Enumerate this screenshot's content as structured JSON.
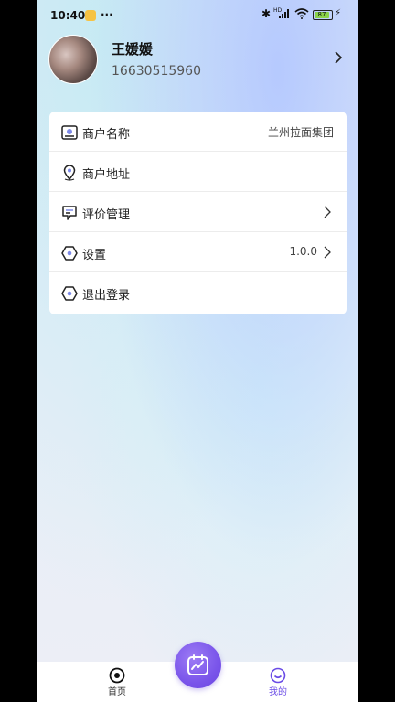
{
  "status_bar": {
    "time": "10:40",
    "dots": "···",
    "hd_label": "HD",
    "battery_level": "87"
  },
  "profile": {
    "name": "王媛媛",
    "phone": "16630515960"
  },
  "menu": {
    "items": [
      {
        "label": "商户名称",
        "value": "兰州拉面集团",
        "icon": "merchant-card-icon"
      },
      {
        "label": "商户地址",
        "value": "",
        "icon": "location-pin-icon"
      },
      {
        "label": "评价管理",
        "value": "",
        "icon": "review-bubble-icon"
      },
      {
        "label": "设置",
        "value": "1.0.0",
        "icon": "settings-hex-icon"
      },
      {
        "label": "退出登录",
        "value": "",
        "icon": "logout-hex-icon"
      }
    ]
  },
  "tabbar": {
    "home_label": "首页",
    "mine_label": "我的",
    "active_color": "#6a4be6",
    "accent_color": "#7a55ea"
  }
}
